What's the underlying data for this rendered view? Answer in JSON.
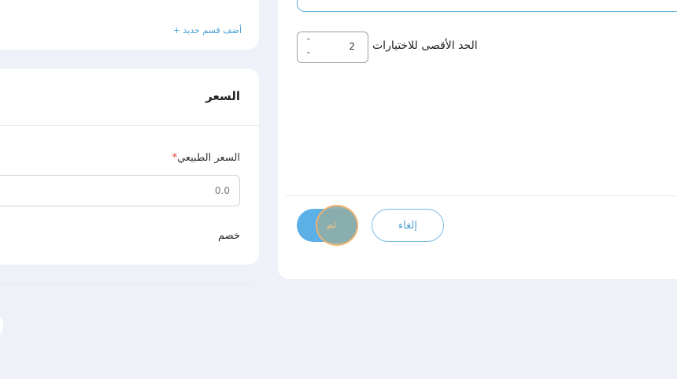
{
  "sections": {
    "add_section_link": "+ أضف قسم جديد"
  },
  "price": {
    "title": "السعر",
    "regular_price_label": "السعر الطبيعي",
    "required_mark": "*",
    "regular_price_placeholder": "0.0",
    "discount_label": "خصم"
  },
  "modal": {
    "max_choices_label": "الحد الأقصى للاختيارات",
    "max_choices_value": "2",
    "stepper_up_icon": "chevron-up-icon",
    "stepper_down_icon": "chevron-down-icon",
    "done_label": "تم",
    "cancel_label": "إلغاء"
  },
  "colors": {
    "background": "#eef1f8",
    "accent": "#5cb0e6",
    "link": "#4a9fd4",
    "required": "#e53935"
  }
}
